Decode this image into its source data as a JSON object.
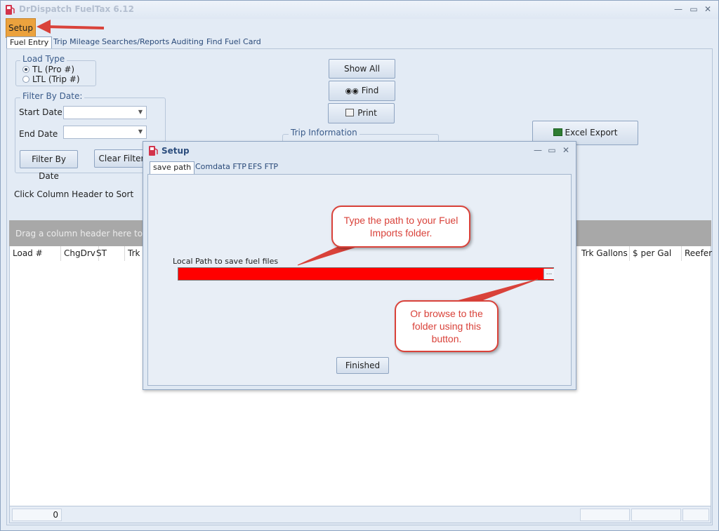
{
  "window": {
    "title": "DrDispatch FuelTax 6.12"
  },
  "menu": {
    "setup_label": "Setup"
  },
  "tabs": [
    "Fuel Entry",
    "Trip Mileage",
    "Searches/Reports",
    "Auditing",
    "Find Fuel Card"
  ],
  "load_type": {
    "title": "Load Type",
    "options": [
      "TL (Pro #)",
      "LTL (Trip #)"
    ],
    "selected": "TL (Pro #)"
  },
  "filter": {
    "title": "Filter By Date:",
    "start_label": "Start Date",
    "end_label": "End Date",
    "start_value": "",
    "end_value": "",
    "filter_button": "Filter By Date",
    "clear_button": "Clear Filter"
  },
  "actions": {
    "show_all": "Show All",
    "find": "Find",
    "print": "Print",
    "excel_export": "Excel Export"
  },
  "trip_info": {
    "title": "Trip Information"
  },
  "sort_hint": "Click Column Header to Sort",
  "grid": {
    "group_hint": "Drag a column header here to gro",
    "columns_left": [
      "Load #",
      "ChgDrv",
      "ST",
      "Trk"
    ],
    "columns_right": [
      "Trk Gallons",
      "$ per Gal",
      "Reefer"
    ],
    "footer_count": "0"
  },
  "dialog": {
    "title": "Setup",
    "tabs": [
      "save path",
      "Comdata FTP",
      "EFS FTP"
    ],
    "path_label": "Local Path to save fuel files",
    "path_value": "",
    "browse_label": "...",
    "finished_button": "Finished"
  },
  "annotations": {
    "callout_path": "Type the path to your Fuel Imports folder.",
    "callout_browse": "Or browse to the folder using this button."
  },
  "colors": {
    "path_field": "#ff0000",
    "callout": "#d9423a",
    "setup_highlight": "#eba23e"
  }
}
